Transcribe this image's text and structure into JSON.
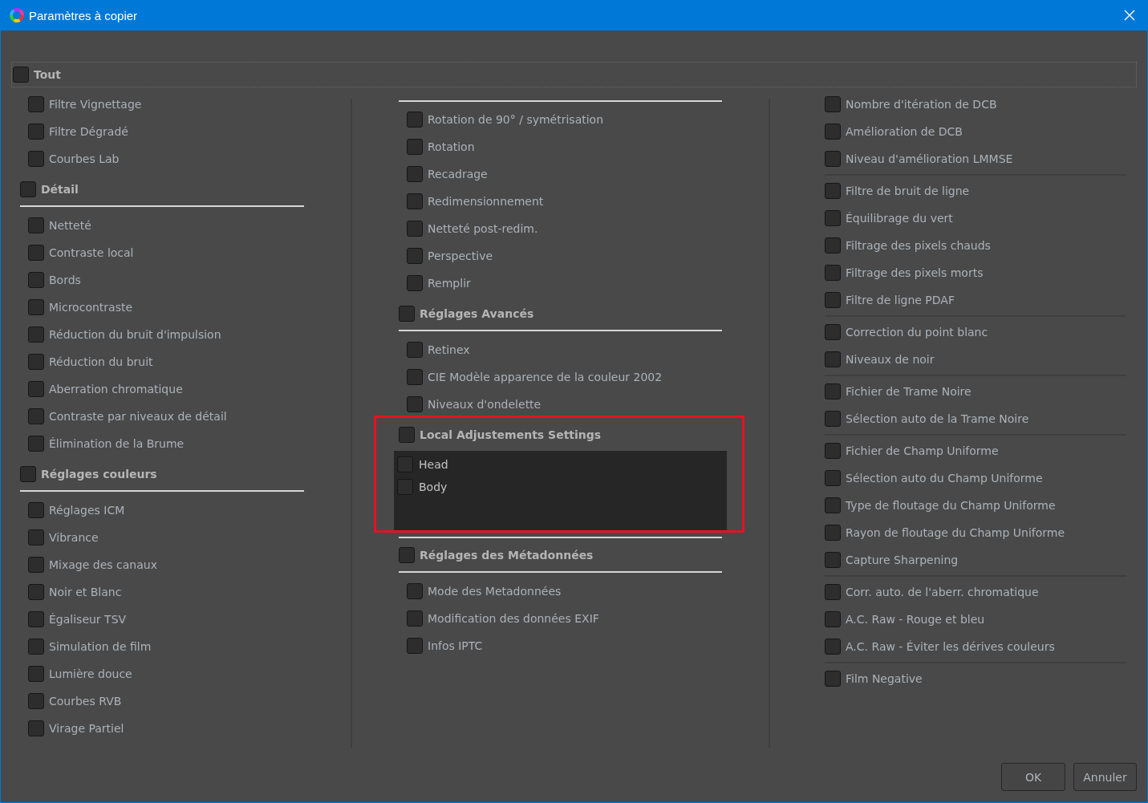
{
  "window": {
    "title": "Paramètres à copier"
  },
  "all": {
    "label": "Tout",
    "checked": false
  },
  "columns": [
    {
      "sections": [
        {
          "items": [
            {
              "label": "Filtre Vignettage",
              "checked": false
            },
            {
              "label": "Filtre Dégradé",
              "checked": false
            },
            {
              "label": "Courbes Lab",
              "checked": false
            }
          ]
        },
        {
          "title": "Détail",
          "checked": false,
          "items": [
            {
              "label": "Netteté",
              "checked": false
            },
            {
              "label": "Contraste local",
              "checked": false
            },
            {
              "label": "Bords",
              "checked": false
            },
            {
              "label": "Microcontraste",
              "checked": false
            },
            {
              "label": "Réduction du bruit d'impulsion",
              "checked": false
            },
            {
              "label": "Réduction du bruit",
              "checked": false
            },
            {
              "label": "Aberration chromatique",
              "checked": false
            },
            {
              "label": "Contraste par niveaux de détail",
              "checked": false
            },
            {
              "label": "Élimination de la Brume",
              "checked": false
            }
          ]
        },
        {
          "title": "Réglages couleurs",
          "checked": false,
          "items": [
            {
              "label": "Réglages ICM",
              "checked": false
            },
            {
              "label": "Vibrance",
              "checked": false
            },
            {
              "label": "Mixage des canaux",
              "checked": false
            },
            {
              "label": "Noir et Blanc",
              "checked": false
            },
            {
              "label": "Égaliseur TSV",
              "checked": false
            },
            {
              "label": "Simulation de film",
              "checked": false
            },
            {
              "label": "Lumière douce",
              "checked": false
            },
            {
              "label": "Courbes RVB",
              "checked": false
            },
            {
              "label": "Virage Partiel",
              "checked": false
            }
          ]
        }
      ]
    },
    {
      "top_rule": true,
      "sections": [
        {
          "items": [
            {
              "label": "Rotation de 90° / symétrisation",
              "checked": false
            },
            {
              "label": "Rotation",
              "checked": false
            },
            {
              "label": "Recadrage",
              "checked": false
            },
            {
              "label": "Redimensionnement",
              "checked": false
            },
            {
              "label": "Netteté post-redim.",
              "checked": false
            },
            {
              "label": "Perspective",
              "checked": false
            },
            {
              "label": "Remplir",
              "checked": false
            }
          ]
        },
        {
          "title": "Réglages Avancés",
          "checked": false,
          "items": [
            {
              "label": "Retinex",
              "checked": false
            },
            {
              "label": "CIE Modèle apparence de la couleur 2002",
              "checked": false
            },
            {
              "label": "Niveaux d'ondelette",
              "checked": false
            }
          ]
        },
        {
          "title": "Local Adjustements Settings",
          "checked": false,
          "kind": "panel",
          "highlighted": true,
          "items": [
            {
              "label": "Head",
              "checked": false
            },
            {
              "label": "Body",
              "checked": false
            }
          ]
        },
        {
          "title": "Réglages des Métadonnées",
          "checked": false,
          "items": [
            {
              "label": "Mode des Metadonnées",
              "checked": false
            },
            {
              "label": "Modification des données EXIF",
              "checked": false
            },
            {
              "label": "Infos IPTC",
              "checked": false
            }
          ]
        }
      ]
    },
    {
      "kind": "groups",
      "sections": [
        {
          "items": [
            {
              "label": "Nombre d'itération de DCB",
              "checked": false
            },
            {
              "label": "Amélioration de DCB",
              "checked": false
            },
            {
              "label": "Niveau d'amélioration LMMSE",
              "checked": false
            }
          ]
        },
        {
          "items": [
            {
              "label": "Filtre de bruit de ligne",
              "checked": false
            },
            {
              "label": "Équilibrage du vert",
              "checked": false
            },
            {
              "label": "Filtrage des pixels chauds",
              "checked": false
            },
            {
              "label": "Filtrage des pixels morts",
              "checked": false
            },
            {
              "label": "Filtre de ligne PDAF",
              "checked": false
            }
          ]
        },
        {
          "items": [
            {
              "label": "Correction du point blanc",
              "checked": false
            },
            {
              "label": "Niveaux de noir",
              "checked": false
            }
          ]
        },
        {
          "items": [
            {
              "label": "Fichier de Trame Noire",
              "checked": false
            },
            {
              "label": "Sélection auto de la Trame Noire",
              "checked": false
            }
          ]
        },
        {
          "items": [
            {
              "label": "Fichier de Champ Uniforme",
              "checked": false
            },
            {
              "label": "Sélection auto du Champ Uniforme",
              "checked": false
            },
            {
              "label": "Type de floutage du Champ Uniforme",
              "checked": false
            },
            {
              "label": "Rayon de floutage du Champ Uniforme",
              "checked": false
            },
            {
              "label": "Capture Sharpening",
              "checked": false
            }
          ]
        },
        {
          "items": [
            {
              "label": "Corr. auto. de l'aberr. chromatique",
              "checked": false
            },
            {
              "label": "A.C. Raw - Rouge et bleu",
              "checked": false
            },
            {
              "label": "A.C. Raw - Éviter les dérives couleurs",
              "checked": false
            }
          ]
        },
        {
          "items": [
            {
              "label": "Film Negative",
              "checked": false
            }
          ]
        }
      ]
    }
  ],
  "buttons": [
    "OK",
    "Annuler"
  ]
}
